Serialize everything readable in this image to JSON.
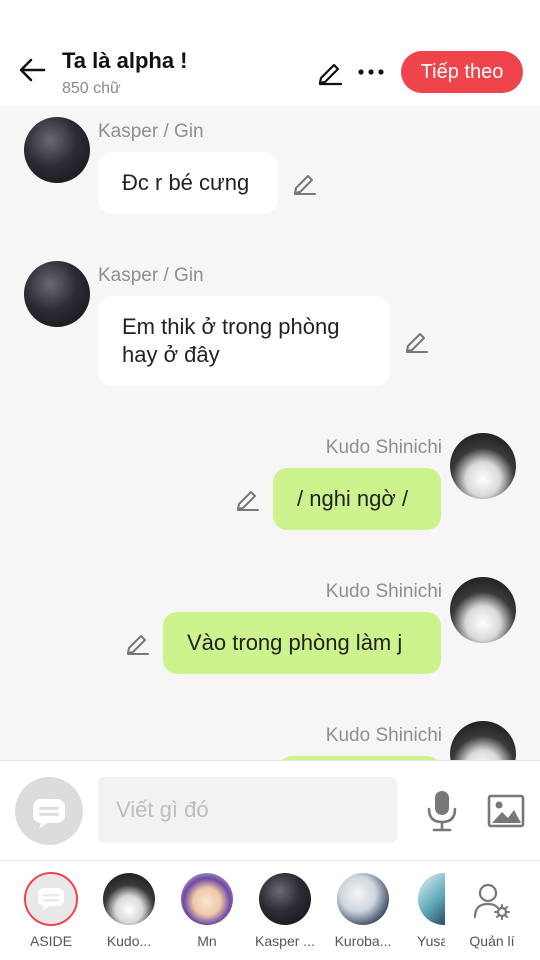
{
  "header": {
    "title": "Ta là alpha !",
    "subtitle": "850 chữ",
    "next_label": "Tiếp theo"
  },
  "messages": [
    {
      "sender": "Kasper / Gin",
      "text_lines": [
        "Đc r bé cưng"
      ],
      "side": "left"
    },
    {
      "sender": "Kasper / Gin",
      "text_lines": [
        "Em thik ở trong phòng",
        "hay ở đây"
      ],
      "side": "left"
    },
    {
      "sender": "Kudo Shinichi",
      "text_lines": [
        "/ nghi ngờ /"
      ],
      "side": "right"
    },
    {
      "sender": "Kudo Shinichi",
      "text_lines": [
        "Vào trong phòng làm j"
      ],
      "side": "right"
    },
    {
      "sender": "Kudo Shinichi",
      "text_lines": [
        ""
      ],
      "side": "right"
    }
  ],
  "composer": {
    "placeholder": "Viết gì đó"
  },
  "characters": [
    {
      "label": "ASIDE"
    },
    {
      "label": "Kudo..."
    },
    {
      "label": "Mn"
    },
    {
      "label": "Kasper ..."
    },
    {
      "label": "Kuroba..."
    },
    {
      "label": "Yusa"
    },
    {
      "label": "Quản lí"
    }
  ],
  "colors": {
    "accent": "#f0444c",
    "outgoing_bubble": "#cdf38e",
    "incoming_bubble": "#ffffff",
    "background": "#f6f6f6"
  },
  "icons": [
    "back-arrow-icon",
    "pencil-icon",
    "more-icon",
    "chat-bubble-icon",
    "microphone-icon",
    "image-icon",
    "manage-users-icon"
  ]
}
